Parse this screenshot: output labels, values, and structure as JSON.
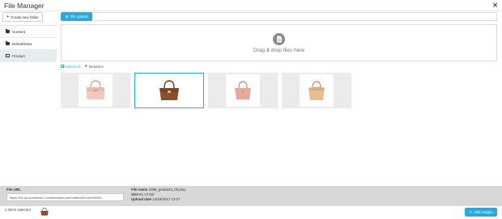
{
  "window": {
    "title": "File Manager",
    "close_icon": "close-icon"
  },
  "toolbar": {
    "create_folder_label": "Create new folder",
    "upload_label": "File upload"
  },
  "sidebar": {
    "folders": [
      {
        "label": "Content",
        "active": false
      },
      {
        "label": "DefaultData",
        "active": false
      },
      {
        "label": "Product",
        "active": true
      }
    ]
  },
  "dropzone": {
    "text": "Drag & drop files here",
    "icon": "document-icon"
  },
  "selection": {
    "select_all": "Select All",
    "deselect": "Deselect"
  },
  "thumbnails": [
    {
      "name": "pink-handbag",
      "color": "#f2c9c2",
      "selected": false
    },
    {
      "name": "brown-handbag",
      "color": "#8a4e2a",
      "selected": true
    },
    {
      "name": "rose-handbag",
      "color": "#e8a99a",
      "selected": false
    },
    {
      "name": "tan-handbag",
      "color": "#e8bd90",
      "selected": false
    }
  ],
  "footer": {
    "file_url_label": "File URL",
    "file_url_value": "https://s3-ap-southeast-1.amazonaws.com/makewebvn/eGlleOu",
    "file_name_label": "File name",
    "file_name_value": "1098_product4_00.png",
    "size_label": "Size",
    "size_value": "51.72 KB",
    "upload_date_label": "Upload date",
    "upload_date_value": "12/19/2017 13:27"
  },
  "status": {
    "items_selected": "1 items selected",
    "add_images_label": "Add Images"
  },
  "colors": {
    "accent": "#29a9e0",
    "footer_bg": "#d8d8d8",
    "active_folder_bg": "#e6edf1"
  }
}
